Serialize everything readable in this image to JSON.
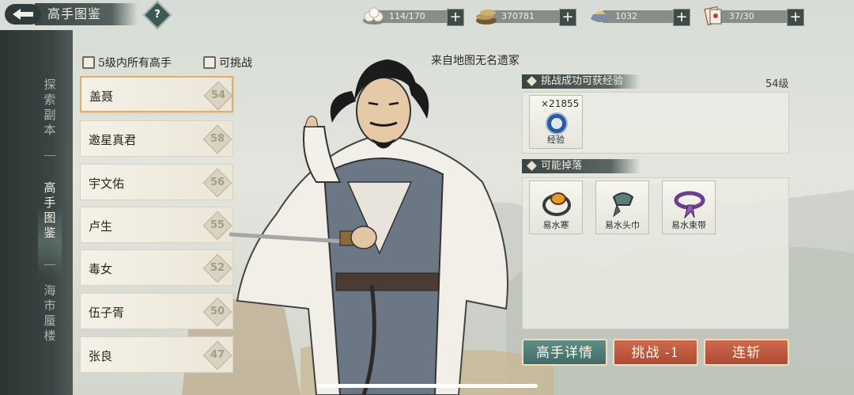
{
  "header": {
    "title": "高手图鉴",
    "help": "?"
  },
  "resources": [
    {
      "icon": "steamed-bun-icon",
      "value": "114/170"
    },
    {
      "icon": "coin-pile-icon",
      "value": "370781"
    },
    {
      "icon": "gold-ingot-icon",
      "value": "1032"
    },
    {
      "icon": "scroll-ticket-icon",
      "value": "37/30"
    }
  ],
  "nav": {
    "tabs": [
      {
        "label": "探索副本"
      },
      {
        "label": "高手图鉴"
      },
      {
        "label": "海市蜃楼"
      }
    ],
    "active": "高手图鉴"
  },
  "filters": {
    "within5": "5级内所有高手",
    "challengeable": "可挑战"
  },
  "roster": [
    {
      "name": "盖聂",
      "level": "54"
    },
    {
      "name": "邀星真君",
      "level": "58"
    },
    {
      "name": "宇文佑",
      "level": "56"
    },
    {
      "name": "卢生",
      "level": "55"
    },
    {
      "name": "毒女",
      "level": "52"
    },
    {
      "name": "伍子胥",
      "level": "50"
    },
    {
      "name": "张良",
      "level": "47"
    }
  ],
  "hero": {
    "source": "来自地图无名遗冢"
  },
  "exp": {
    "title": "挑战成功可获经验",
    "level": "54级",
    "qty": "×21855",
    "item": "经验"
  },
  "drops": {
    "title": "可能掉落",
    "items": [
      "易水寒",
      "易水头巾",
      "易水束带"
    ]
  },
  "actions": {
    "details": "高手详情",
    "challenge": "挑战 -1",
    "sweep": "连斩"
  },
  "colors": {
    "accent_red": "#ad4a34",
    "accent_teal": "#3f6c67",
    "selected_border": "#e0ae6a"
  }
}
